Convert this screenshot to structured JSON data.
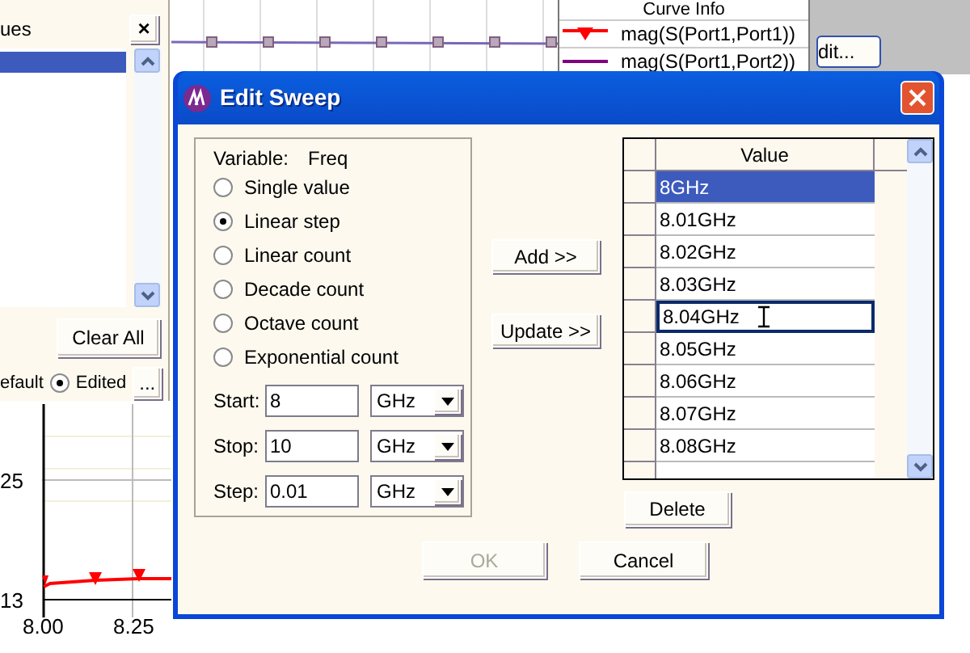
{
  "left_panel": {
    "title": "ues",
    "close": "×",
    "list": [
      {
        "selected": true
      }
    ],
    "clear_button": "Clear All",
    "cut_label": "efault",
    "radios": [
      {
        "label": "Edited",
        "selected": true
      }
    ],
    "more_button": "..."
  },
  "curve_info": {
    "title": "Curve Info",
    "curves": [
      {
        "name": "mag(S(Port1,Port1))",
        "color": "#ff0000",
        "kind": "marker"
      },
      {
        "name": "mag(S(Port1,Port2))",
        "color": "#800080",
        "kind": "line"
      }
    ]
  },
  "edit_button": "dit...",
  "bottom_plot": {
    "y_ticks": [
      "25",
      "13"
    ],
    "x_ticks": [
      "8.00",
      "8.25"
    ]
  },
  "dialog": {
    "title": "Edit Sweep",
    "variable_label": "Variable:",
    "variable_value": "Freq",
    "sweep_types": [
      {
        "label": "Single value",
        "selected": false
      },
      {
        "label": "Linear step",
        "selected": true
      },
      {
        "label": "Linear count",
        "selected": false
      },
      {
        "label": "Decade count",
        "selected": false
      },
      {
        "label": "Octave count",
        "selected": false
      },
      {
        "label": "Exponential count",
        "selected": false
      }
    ],
    "fields": [
      {
        "label": "Start:",
        "value": "8",
        "unit": "GHz"
      },
      {
        "label": "Stop:",
        "value": "10",
        "unit": "GHz"
      },
      {
        "label": "Step:",
        "value": "0.01",
        "unit": "GHz"
      }
    ],
    "add_button": "Add >>",
    "update_button": "Update >>",
    "grid": {
      "column": "Value",
      "rows": [
        {
          "value": "8GHz",
          "selected": true,
          "editing": false
        },
        {
          "value": "8.01GHz",
          "selected": false,
          "editing": false
        },
        {
          "value": "8.02GHz",
          "selected": false,
          "editing": false
        },
        {
          "value": "8.03GHz",
          "selected": false,
          "editing": false
        },
        {
          "value": "8.04GHz",
          "selected": false,
          "editing": true
        },
        {
          "value": "8.05GHz",
          "selected": false,
          "editing": false
        },
        {
          "value": "8.06GHz",
          "selected": false,
          "editing": false
        },
        {
          "value": "8.07GHz",
          "selected": false,
          "editing": false
        },
        {
          "value": "8.08GHz",
          "selected": false,
          "editing": false
        }
      ]
    },
    "delete_button": "Delete",
    "ok_button": {
      "label": "OK",
      "disabled": true
    },
    "cancel_button": "Cancel"
  }
}
